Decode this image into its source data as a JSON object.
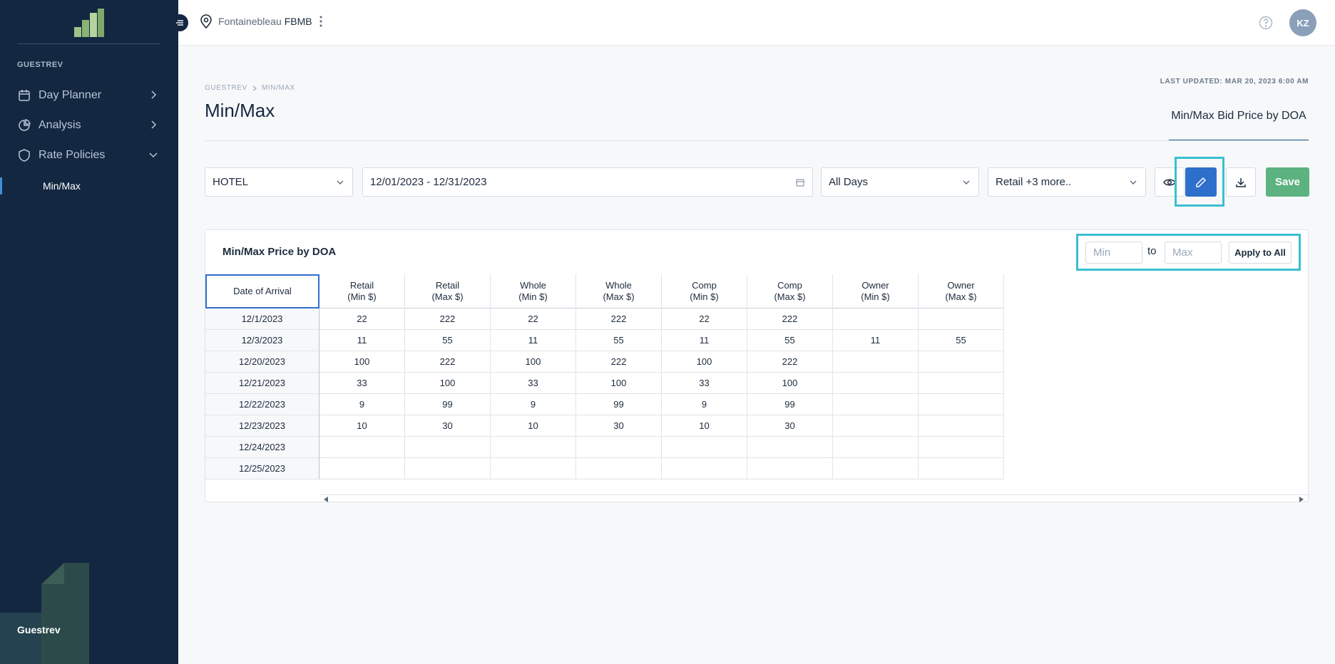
{
  "sidebar": {
    "section_label": "GUESTREV",
    "items": [
      {
        "label": "Day Planner",
        "icon": "calendar-icon"
      },
      {
        "label": "Analysis",
        "icon": "pie-chart-icon"
      },
      {
        "label": "Rate Policies",
        "icon": "shield-icon"
      }
    ],
    "active_sub": "Min/Max",
    "brand": "Guestrev"
  },
  "topbar": {
    "location_prefix": "Fontainebleau",
    "location_name": "FBMB",
    "avatar_initials": "KZ"
  },
  "header": {
    "breadcrumb": [
      "GUESTREV",
      "MIN/MAX"
    ],
    "title": "Min/Max",
    "last_updated": "LAST UPDATED: MAR 20, 2023 6:00 AM",
    "tab": "Min/Max Bid Price by DOA"
  },
  "filters": {
    "property": "HOTEL",
    "date_range": "12/01/2023 - 12/31/2023",
    "days": "All Days",
    "segments": "Retail +3 more..",
    "save_label": "Save"
  },
  "card": {
    "title": "Min/Max Price by DOA",
    "min_placeholder": "Min",
    "to_label": "to",
    "max_placeholder": "Max",
    "apply_label": "Apply to All"
  },
  "table": {
    "columns": [
      "Date of Arrival",
      "Retail\n(Min $)",
      "Retail\n(Max $)",
      "Whole\n(Min $)",
      "Whole\n(Max $)",
      "Comp\n(Min $)",
      "Comp\n(Max $)",
      "Owner\n(Min $)",
      "Owner\n(Max $)"
    ],
    "rows": [
      [
        "12/1/2023",
        "22",
        "222",
        "22",
        "222",
        "22",
        "222",
        "",
        ""
      ],
      [
        "12/3/2023",
        "11",
        "55",
        "11",
        "55",
        "11",
        "55",
        "11",
        "55"
      ],
      [
        "12/20/2023",
        "100",
        "222",
        "100",
        "222",
        "100",
        "222",
        "",
        ""
      ],
      [
        "12/21/2023",
        "33",
        "100",
        "33",
        "100",
        "33",
        "100",
        "",
        ""
      ],
      [
        "12/22/2023",
        "9",
        "99",
        "9",
        "99",
        "9",
        "99",
        "",
        ""
      ],
      [
        "12/23/2023",
        "10",
        "30",
        "10",
        "30",
        "10",
        "30",
        "",
        ""
      ],
      [
        "12/24/2023",
        "",
        "",
        "",
        "",
        "",
        "",
        "",
        ""
      ],
      [
        "12/25/2023",
        "",
        "",
        "",
        "",
        "",
        "",
        "",
        ""
      ]
    ]
  },
  "colors": {
    "sidebar_bg": "#132741",
    "primary": "#2e6fcc",
    "save": "#5cb37f",
    "highlight": "#3bbfd1"
  }
}
